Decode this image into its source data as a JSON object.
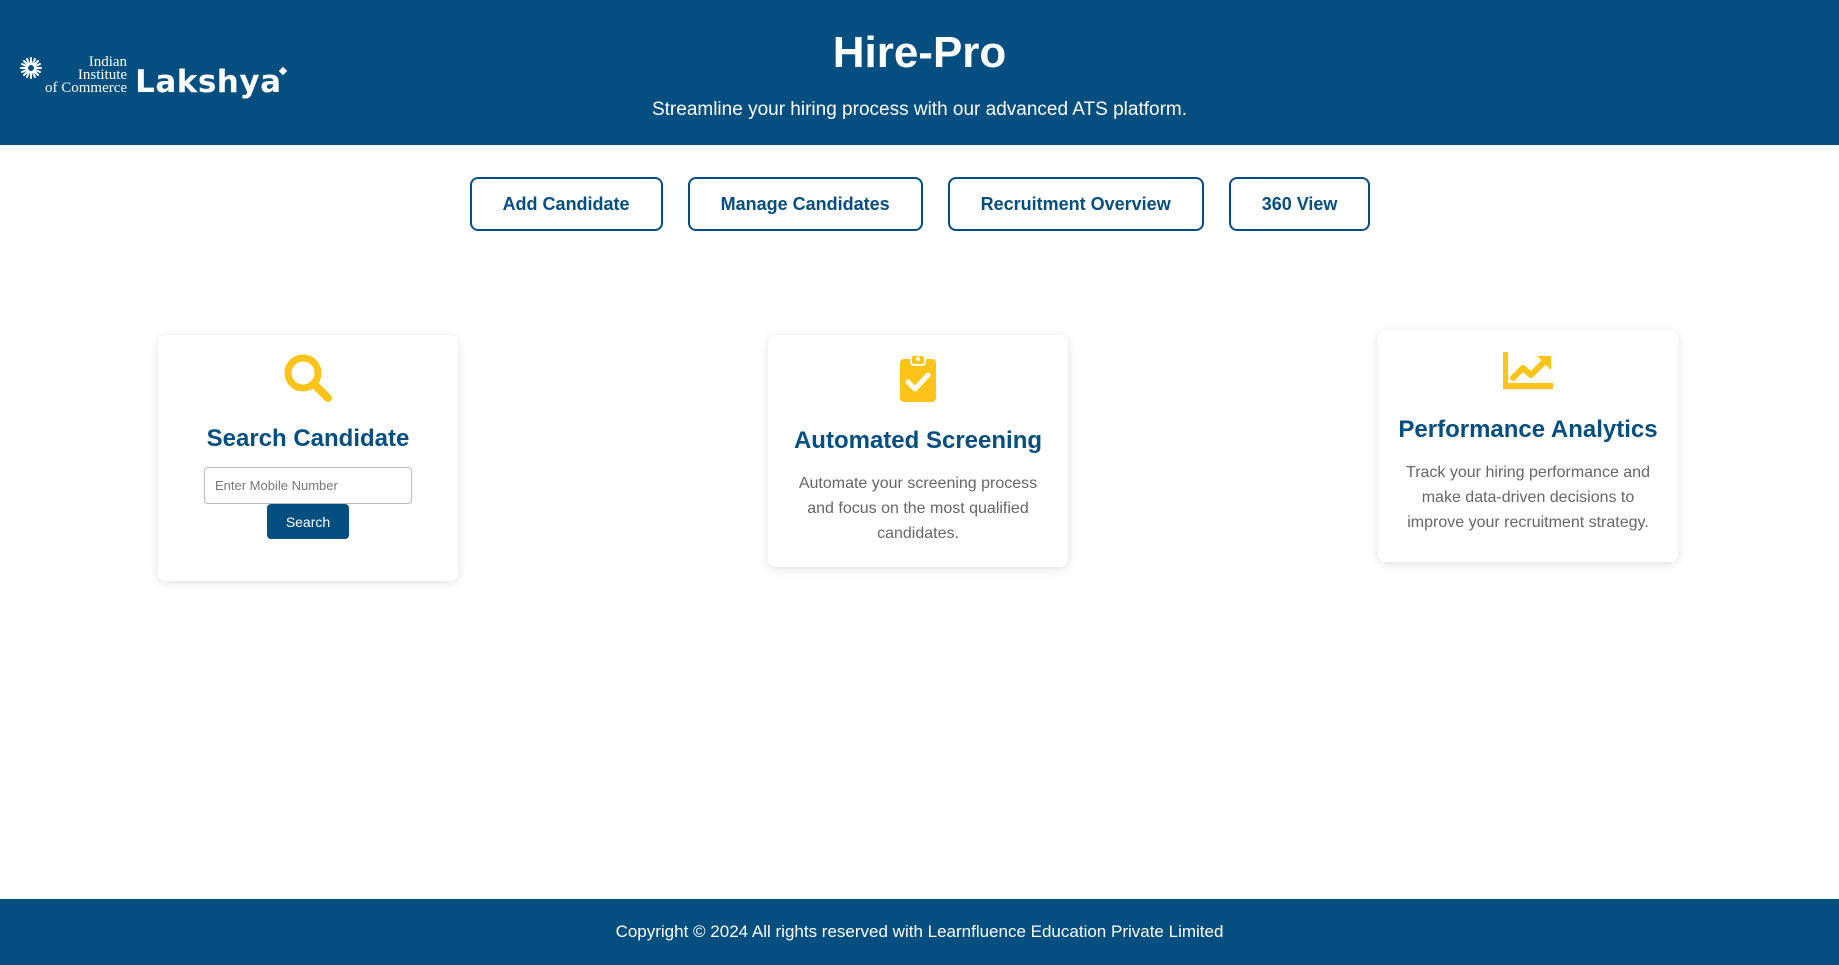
{
  "brand": {
    "logo_line1": "Indian",
    "logo_line2": "Institute",
    "logo_line3": "of Commerce",
    "logo_name": "Lakshya"
  },
  "header": {
    "title": "Hire-Pro",
    "subtitle": "Streamline your hiring process with our advanced ATS platform."
  },
  "nav": {
    "items": [
      {
        "label": "Add Candidate"
      },
      {
        "label": "Manage Candidates"
      },
      {
        "label": "Recruitment Overview"
      },
      {
        "label": "360 View"
      }
    ]
  },
  "cards": {
    "search": {
      "title": "Search Candidate",
      "input_placeholder": "Enter Mobile Number",
      "input_value": "",
      "button_label": "Search",
      "icon": "search-icon"
    },
    "screening": {
      "title": "Automated Screening",
      "description": "Automate your screening process and focus on the most qualified candidates.",
      "icon": "clipboard-check-icon"
    },
    "analytics": {
      "title": "Performance Analytics",
      "description": "Track your hiring performance and make data-driven decisions to improve your recruitment strategy.",
      "icon": "chart-line-icon"
    }
  },
  "footer": {
    "text": "Copyright © 2024 All rights reserved with Learnfluence Education Private Limited"
  },
  "colors": {
    "primary": "#044e80",
    "accent": "#fcc419",
    "text_muted": "#666666"
  }
}
